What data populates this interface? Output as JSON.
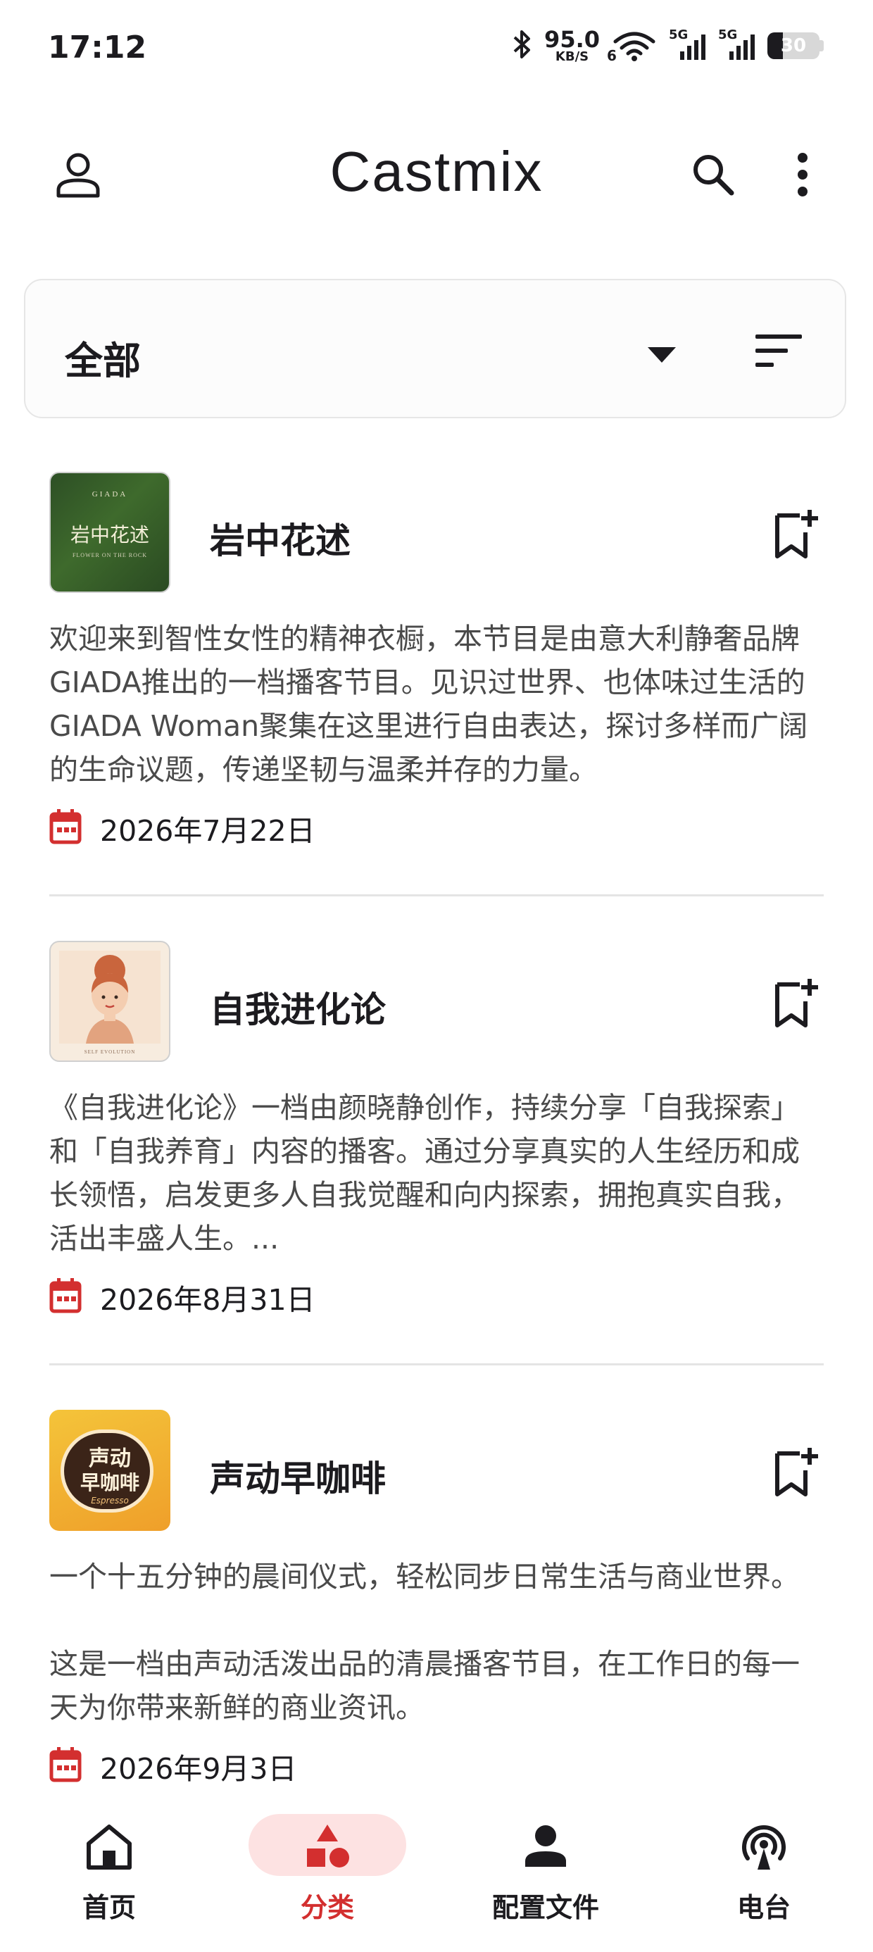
{
  "status_bar": {
    "time": "17:12",
    "net_speed_value": "95.0",
    "net_speed_unit": "KB/S",
    "wifi_sub": "6",
    "signal_1": "5G",
    "signal_2": "5G",
    "battery_level": "30",
    "battery_fraction": 0.3
  },
  "app_bar": {
    "title": "Castmix",
    "icons": [
      "profile-icon",
      "search-icon",
      "more-vert-icon"
    ]
  },
  "filter": {
    "selected": "全部",
    "icons": [
      "dropdown-arrow-icon",
      "sort-icon"
    ]
  },
  "podcasts": [
    {
      "title": "岩中花述",
      "cover_brand": "GIADA",
      "cover_title": "岩中花述",
      "cover_sub": "FLOWER ON THE ROCK",
      "description": "欢迎来到智性女性的精神衣橱，本节目是由意大利静奢品牌GIADA推出的一档播客节目。见识过世界、也体味过生活的GIADA Woman聚集在这里进行自由表达，探讨多样而广阔的生命议题，传递坚韧与温柔并存的力量。",
      "date": "2026年7月22日"
    },
    {
      "title": "自我进化论",
      "cover_sub": "SELF EVOLUTION",
      "description": "《自我进化论》一档由颜晓静创作，持续分享「自我探索」和「自我养育」内容的播客。通过分享真实的人生经历和成长领悟，启发更多人自我觉醒和向内探索，拥抱真实自我，活出丰盛人生。...",
      "date": "2026年8月31日"
    },
    {
      "title": "声动早咖啡",
      "cover_title_1": "声动",
      "cover_title_2": "早咖啡",
      "cover_sub": "Espresso",
      "description": "一个十五分钟的晨间仪式，轻松同步日常生活与商业世界。\n\n这是一档由声动活泼出品的清晨播客节目，在工作日的每一天为你带来新鲜的商业资讯。",
      "date": "2026年9月3日"
    }
  ],
  "bottom_nav": {
    "items": [
      {
        "label": "首页",
        "icon": "home-icon",
        "active": false
      },
      {
        "label": "分类",
        "icon": "category-icon",
        "active": true
      },
      {
        "label": "配置文件",
        "icon": "person-icon",
        "active": false
      },
      {
        "label": "电台",
        "icon": "radio-icon",
        "active": false
      }
    ]
  },
  "colors": {
    "accent": "#d32f2f",
    "pill": "#fde2e2",
    "text": "#1c1b1f",
    "secondary_text": "#4a4a4a",
    "divider": "#e4e4e4"
  }
}
